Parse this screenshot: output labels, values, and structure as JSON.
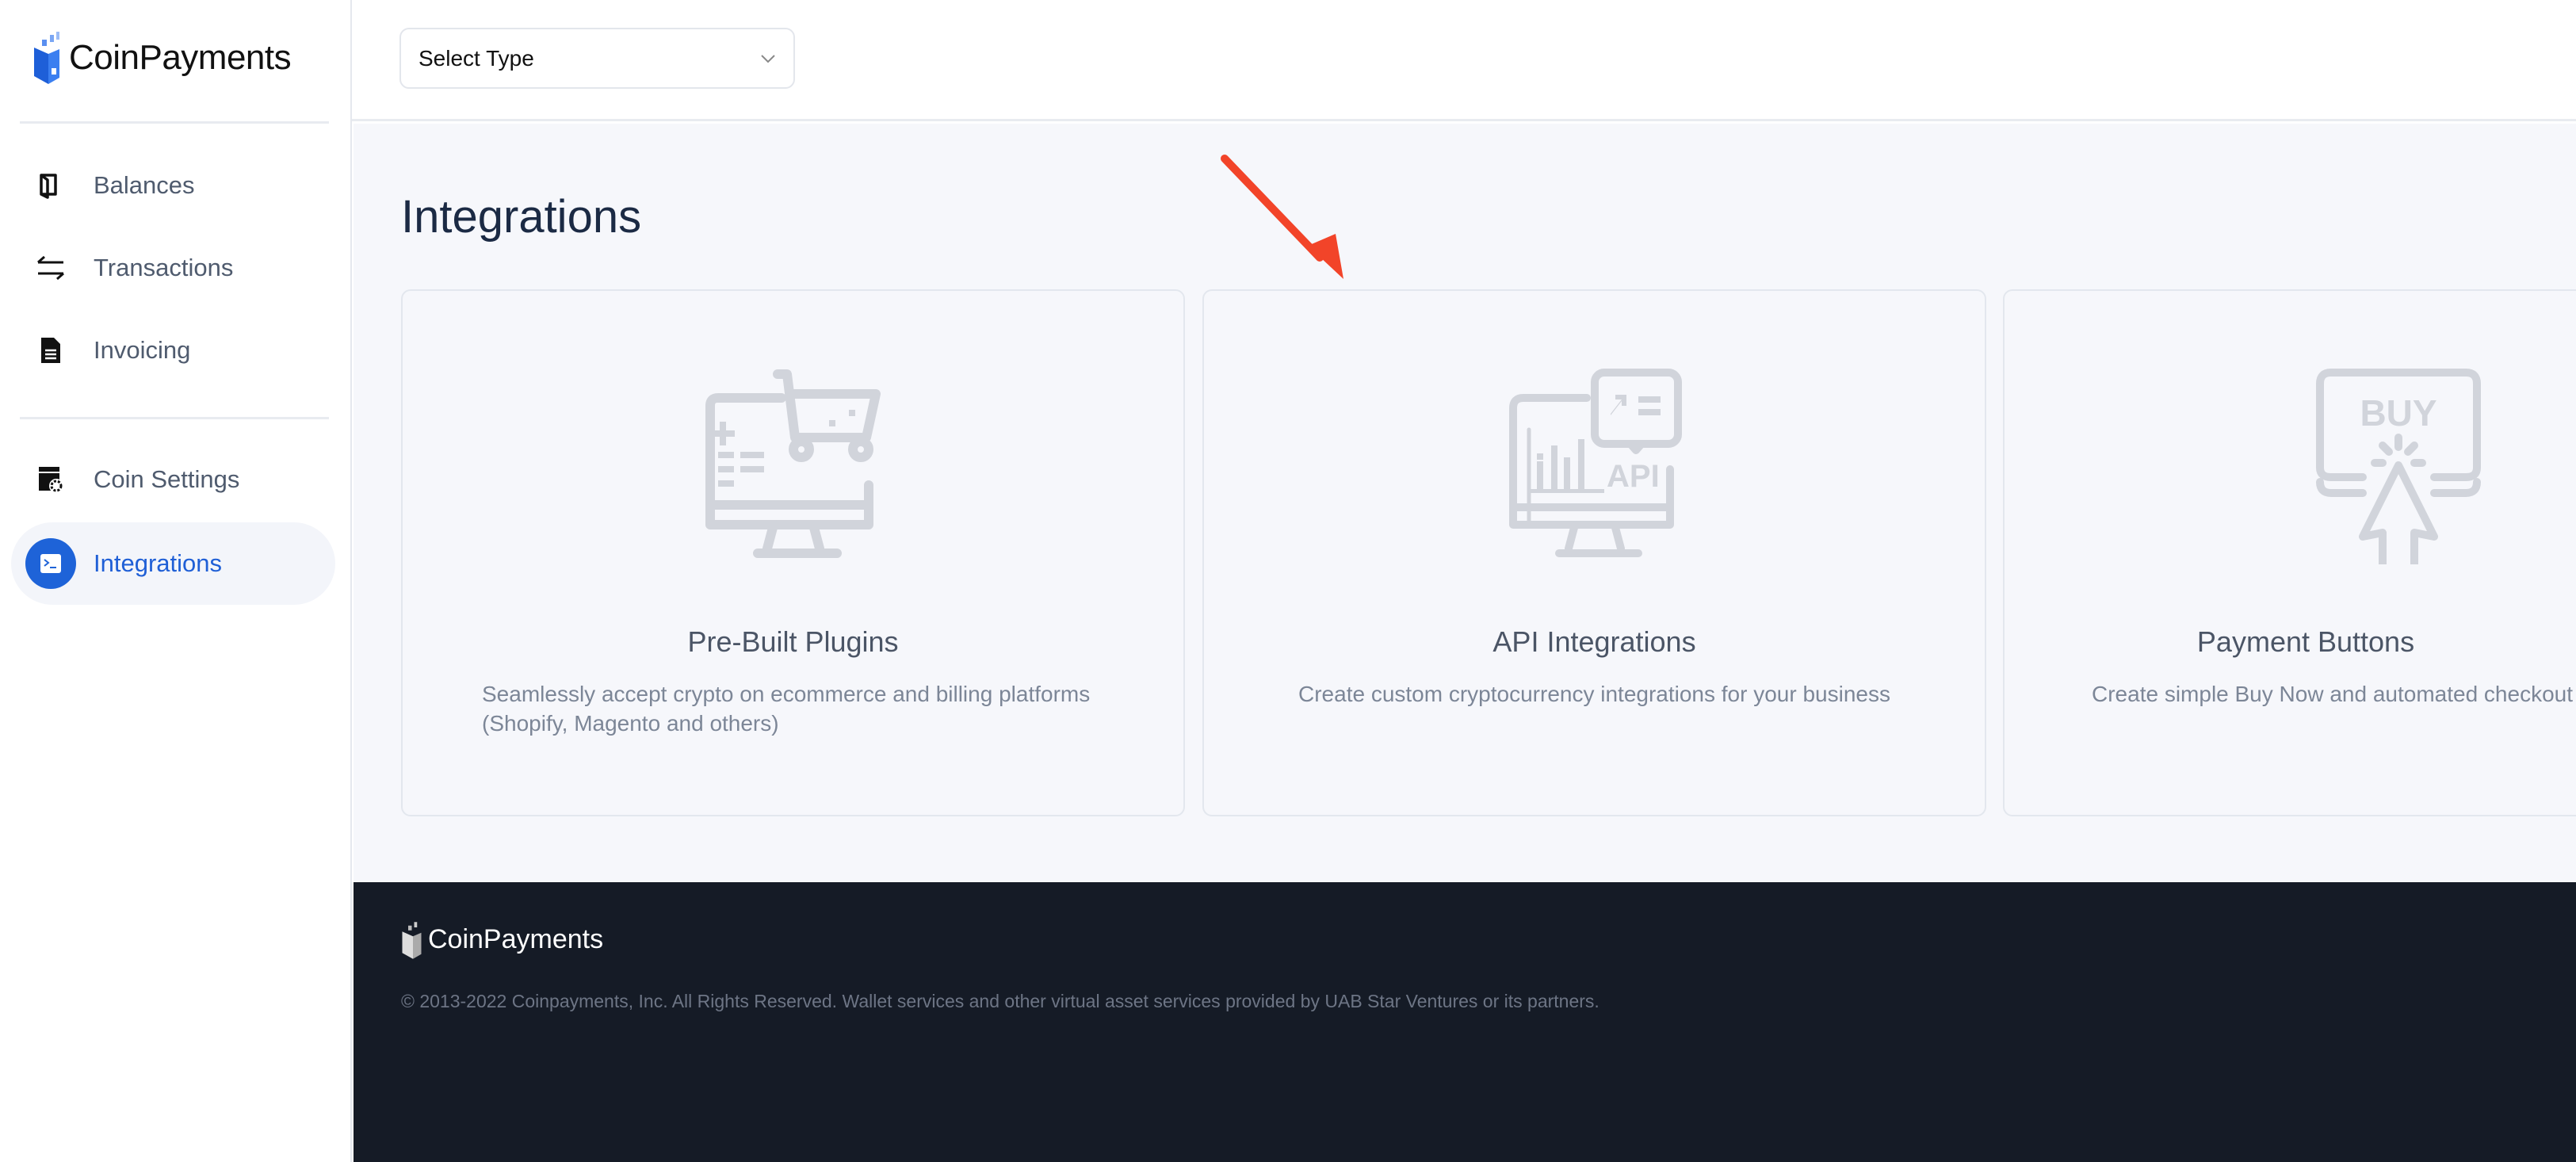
{
  "brand": {
    "name": "CoinPayments",
    "accent": "#1e63d8"
  },
  "sidebar": {
    "items": [
      {
        "label": "Balances",
        "icon": "wallet-icon"
      },
      {
        "label": "Transactions",
        "icon": "arrows-swap-icon"
      },
      {
        "label": "Invoicing",
        "icon": "document-icon"
      },
      {
        "label": "Coin Settings",
        "icon": "coin-settings-icon"
      },
      {
        "label": "Integrations",
        "icon": "terminal-icon",
        "active": true
      }
    ]
  },
  "header": {
    "select": {
      "value": "Select Type"
    }
  },
  "main": {
    "title": "Integrations",
    "cards": [
      {
        "title": "Pre-Built Plugins",
        "description": "Seamlessly accept crypto on ecommerce and billing platforms (Shopify, Magento and others)",
        "icon": "cart-monitor-icon"
      },
      {
        "title": "API Integrations",
        "description": "Create custom cryptocurrency integrations for your business",
        "icon": "api-monitor-icon"
      },
      {
        "title": "Payment Buttons",
        "description": "Create simple Buy Now and automated checkout",
        "icon": "buy-button-icon"
      }
    ]
  },
  "footer": {
    "brand": "CoinPayments",
    "copyright": "© 2013-2022 Coinpayments, Inc. All Rights Reserved. Wallet services and other virtual asset services provided by UAB Star Ventures or its partners."
  },
  "annotation": {
    "color": "#f24429"
  }
}
